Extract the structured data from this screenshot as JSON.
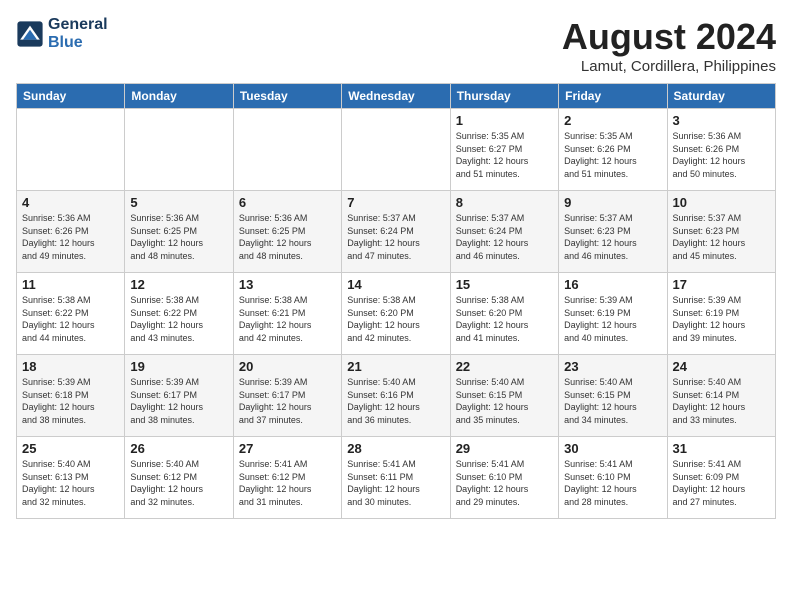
{
  "header": {
    "logo_line1": "General",
    "logo_line2": "Blue",
    "title": "August 2024",
    "subtitle": "Lamut, Cordillera, Philippines"
  },
  "weekdays": [
    "Sunday",
    "Monday",
    "Tuesday",
    "Wednesday",
    "Thursday",
    "Friday",
    "Saturday"
  ],
  "weeks": [
    [
      {
        "day": "",
        "info": ""
      },
      {
        "day": "",
        "info": ""
      },
      {
        "day": "",
        "info": ""
      },
      {
        "day": "",
        "info": ""
      },
      {
        "day": "1",
        "info": "Sunrise: 5:35 AM\nSunset: 6:27 PM\nDaylight: 12 hours\nand 51 minutes."
      },
      {
        "day": "2",
        "info": "Sunrise: 5:35 AM\nSunset: 6:26 PM\nDaylight: 12 hours\nand 51 minutes."
      },
      {
        "day": "3",
        "info": "Sunrise: 5:36 AM\nSunset: 6:26 PM\nDaylight: 12 hours\nand 50 minutes."
      }
    ],
    [
      {
        "day": "4",
        "info": "Sunrise: 5:36 AM\nSunset: 6:26 PM\nDaylight: 12 hours\nand 49 minutes."
      },
      {
        "day": "5",
        "info": "Sunrise: 5:36 AM\nSunset: 6:25 PM\nDaylight: 12 hours\nand 48 minutes."
      },
      {
        "day": "6",
        "info": "Sunrise: 5:36 AM\nSunset: 6:25 PM\nDaylight: 12 hours\nand 48 minutes."
      },
      {
        "day": "7",
        "info": "Sunrise: 5:37 AM\nSunset: 6:24 PM\nDaylight: 12 hours\nand 47 minutes."
      },
      {
        "day": "8",
        "info": "Sunrise: 5:37 AM\nSunset: 6:24 PM\nDaylight: 12 hours\nand 46 minutes."
      },
      {
        "day": "9",
        "info": "Sunrise: 5:37 AM\nSunset: 6:23 PM\nDaylight: 12 hours\nand 46 minutes."
      },
      {
        "day": "10",
        "info": "Sunrise: 5:37 AM\nSunset: 6:23 PM\nDaylight: 12 hours\nand 45 minutes."
      }
    ],
    [
      {
        "day": "11",
        "info": "Sunrise: 5:38 AM\nSunset: 6:22 PM\nDaylight: 12 hours\nand 44 minutes."
      },
      {
        "day": "12",
        "info": "Sunrise: 5:38 AM\nSunset: 6:22 PM\nDaylight: 12 hours\nand 43 minutes."
      },
      {
        "day": "13",
        "info": "Sunrise: 5:38 AM\nSunset: 6:21 PM\nDaylight: 12 hours\nand 42 minutes."
      },
      {
        "day": "14",
        "info": "Sunrise: 5:38 AM\nSunset: 6:20 PM\nDaylight: 12 hours\nand 42 minutes."
      },
      {
        "day": "15",
        "info": "Sunrise: 5:38 AM\nSunset: 6:20 PM\nDaylight: 12 hours\nand 41 minutes."
      },
      {
        "day": "16",
        "info": "Sunrise: 5:39 AM\nSunset: 6:19 PM\nDaylight: 12 hours\nand 40 minutes."
      },
      {
        "day": "17",
        "info": "Sunrise: 5:39 AM\nSunset: 6:19 PM\nDaylight: 12 hours\nand 39 minutes."
      }
    ],
    [
      {
        "day": "18",
        "info": "Sunrise: 5:39 AM\nSunset: 6:18 PM\nDaylight: 12 hours\nand 38 minutes."
      },
      {
        "day": "19",
        "info": "Sunrise: 5:39 AM\nSunset: 6:17 PM\nDaylight: 12 hours\nand 38 minutes."
      },
      {
        "day": "20",
        "info": "Sunrise: 5:39 AM\nSunset: 6:17 PM\nDaylight: 12 hours\nand 37 minutes."
      },
      {
        "day": "21",
        "info": "Sunrise: 5:40 AM\nSunset: 6:16 PM\nDaylight: 12 hours\nand 36 minutes."
      },
      {
        "day": "22",
        "info": "Sunrise: 5:40 AM\nSunset: 6:15 PM\nDaylight: 12 hours\nand 35 minutes."
      },
      {
        "day": "23",
        "info": "Sunrise: 5:40 AM\nSunset: 6:15 PM\nDaylight: 12 hours\nand 34 minutes."
      },
      {
        "day": "24",
        "info": "Sunrise: 5:40 AM\nSunset: 6:14 PM\nDaylight: 12 hours\nand 33 minutes."
      }
    ],
    [
      {
        "day": "25",
        "info": "Sunrise: 5:40 AM\nSunset: 6:13 PM\nDaylight: 12 hours\nand 32 minutes."
      },
      {
        "day": "26",
        "info": "Sunrise: 5:40 AM\nSunset: 6:12 PM\nDaylight: 12 hours\nand 32 minutes."
      },
      {
        "day": "27",
        "info": "Sunrise: 5:41 AM\nSunset: 6:12 PM\nDaylight: 12 hours\nand 31 minutes."
      },
      {
        "day": "28",
        "info": "Sunrise: 5:41 AM\nSunset: 6:11 PM\nDaylight: 12 hours\nand 30 minutes."
      },
      {
        "day": "29",
        "info": "Sunrise: 5:41 AM\nSunset: 6:10 PM\nDaylight: 12 hours\nand 29 minutes."
      },
      {
        "day": "30",
        "info": "Sunrise: 5:41 AM\nSunset: 6:10 PM\nDaylight: 12 hours\nand 28 minutes."
      },
      {
        "day": "31",
        "info": "Sunrise: 5:41 AM\nSunset: 6:09 PM\nDaylight: 12 hours\nand 27 minutes."
      }
    ]
  ]
}
